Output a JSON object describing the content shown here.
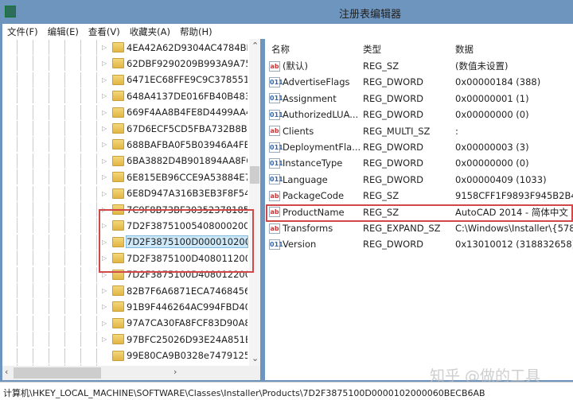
{
  "window": {
    "title": "注册表编辑器",
    "icon": "regedit-icon"
  },
  "menu": [
    "文件(F)",
    "编辑(E)",
    "查看(V)",
    "收藏夹(A)",
    "帮助(H)"
  ],
  "tree": {
    "keys": [
      "4EA42A62D9304AC4784BF2",
      "62DBF9290209B993A9A757",
      "6471EC68FFE9C9C3785518",
      "648A4137DE016FB40B483D",
      "669F4AA8B4FE8D4499AA4C",
      "67D6ECF5CD5FBA732B8B2",
      "688BAFBA0F5B03946A4FBD",
      "6BA3882D4B901894AA8F6E",
      "6E815EB96CCE9A53884E78",
      "6E8D947A316B3EB3F8F540",
      "7C9F8B73BF303523781852",
      "7D2F387510054080002000",
      "7D2F3875100D0000102000",
      "7D2F3875100D4080112000",
      "7D2F3875100D4080122000",
      "82B7F6A6871ECA7468456A",
      "91B9F446264AC994FBD403",
      "97A7CA30FA8FCF83D90A89",
      "97BFC25026D93E24A851ED",
      "99E80CA9B0328e74791254",
      "9A6CE1FEED719AD30B0480"
    ],
    "selected_index": 12,
    "highlighted_range": [
      11,
      14
    ]
  },
  "list": {
    "headers": {
      "name": "名称",
      "type": "类型",
      "data": "数据"
    },
    "rows": [
      {
        "icon": "string-value-icon",
        "name": "(默认)",
        "type": "REG_SZ",
        "data": "(数值未设置)"
      },
      {
        "icon": "binary-value-icon",
        "name": "AdvertiseFlags",
        "type": "REG_DWORD",
        "data": "0x00000184 (388)"
      },
      {
        "icon": "binary-value-icon",
        "name": "Assignment",
        "type": "REG_DWORD",
        "data": "0x00000001 (1)"
      },
      {
        "icon": "binary-value-icon",
        "name": "AuthorizedLUA...",
        "type": "REG_DWORD",
        "data": "0x00000000 (0)"
      },
      {
        "icon": "string-value-icon",
        "name": "Clients",
        "type": "REG_MULTI_SZ",
        "data": ":"
      },
      {
        "icon": "binary-value-icon",
        "name": "DeploymentFla...",
        "type": "REG_DWORD",
        "data": "0x00000003 (3)"
      },
      {
        "icon": "binary-value-icon",
        "name": "InstanceType",
        "type": "REG_DWORD",
        "data": "0x00000000 (0)"
      },
      {
        "icon": "binary-value-icon",
        "name": "Language",
        "type": "REG_DWORD",
        "data": "0x00000409 (1033)"
      },
      {
        "icon": "string-value-icon",
        "name": "PackageCode",
        "type": "REG_SZ",
        "data": "9158CFF1F9893F945B2B41"
      },
      {
        "icon": "string-value-icon",
        "name": "ProductName",
        "type": "REG_SZ",
        "data": "AutoCAD 2014 - 简体中文 ("
      },
      {
        "icon": "string-value-icon",
        "name": "Transforms",
        "type": "REG_EXPAND_SZ",
        "data": "C:\\Windows\\Installer\\{5783"
      },
      {
        "icon": "binary-value-icon",
        "name": "Version",
        "type": "REG_DWORD",
        "data": "0x13010012 (318832658)"
      }
    ],
    "highlighted_index": 9
  },
  "status_path": "计算机\\HKEY_LOCAL_MACHINE\\SOFTWARE\\Classes\\Installer\\Products\\7D2F3875100D0000102000060BECB6AB",
  "watermark": "知乎 @做的工具",
  "colors": {
    "titlebar": "#6d95be",
    "highlight_box": "#d04848",
    "selection": "#cde8f8"
  }
}
